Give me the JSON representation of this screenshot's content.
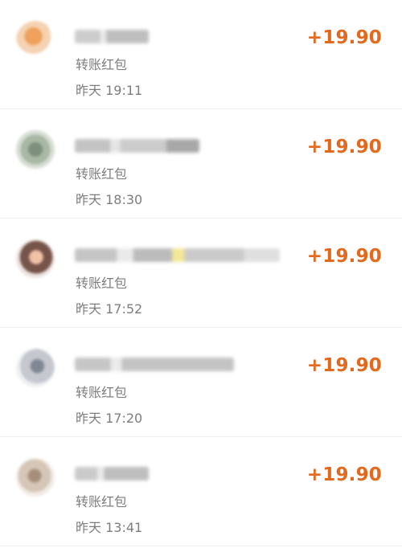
{
  "transactions": [
    {
      "subtitle": "转账红包",
      "time": "昨天 19:11",
      "amount": "+19.90"
    },
    {
      "subtitle": "转账红包",
      "time": "昨天 18:30",
      "amount": "+19.90"
    },
    {
      "subtitle": "转账红包",
      "time": "昨天 17:52",
      "amount": "+19.90"
    },
    {
      "subtitle": "转账红包",
      "time": "昨天 17:20",
      "amount": "+19.90"
    },
    {
      "subtitle": "转账红包",
      "time": "昨天 13:41",
      "amount": "+19.90"
    }
  ],
  "colors": {
    "amount": "#e36a1d",
    "secondary_text": "#7d7d7d",
    "divider": "#eeeeee",
    "background": "#ffffff"
  }
}
